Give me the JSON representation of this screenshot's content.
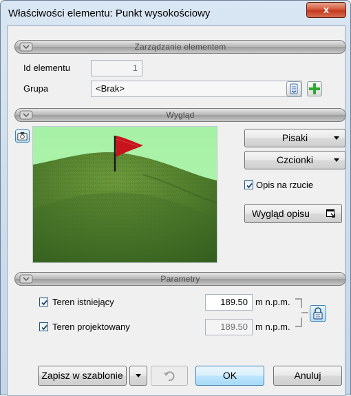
{
  "window": {
    "title": "Właściwości elementu: Punkt wysokościowy",
    "close_glyph": "x"
  },
  "sections": {
    "management": {
      "title": "Zarządzanie elementem"
    },
    "appearance": {
      "title": "Wygląd"
    },
    "parameters": {
      "title": "Parametry"
    }
  },
  "management": {
    "id_label": "Id elementu",
    "id_value": "1",
    "group_label": "Grupa",
    "group_value": "<Brak>"
  },
  "appearance": {
    "pens_label": "Pisaki",
    "fonts_label": "Czcionki",
    "plan_description_label": "Opis na rzucie",
    "plan_description_checked": true,
    "description_look_label": "Wygląd opisu"
  },
  "parameters": {
    "existing_label": "Teren istniejący",
    "existing_checked": true,
    "existing_value": "189.50",
    "existing_unit": "m n.p.m.",
    "designed_label": "Teren projektowany",
    "designed_checked": true,
    "designed_value": "189.50",
    "designed_unit": "m n.p.m."
  },
  "footer": {
    "save_template_label": "Zapisz w szablonie",
    "ok_label": "OK",
    "cancel_label": "Anuluj"
  },
  "colors": {
    "terrain_green": "#4a7a2a",
    "sky_green": "#a8f0a8",
    "flag_red": "#c8141c",
    "accent_blue": "#3c7fb1"
  },
  "icons": [
    "close-icon",
    "collapse-icon",
    "camera-icon",
    "group-picker-icon",
    "add-icon",
    "chevron-down-icon",
    "popout-icon",
    "undo-icon",
    "lock-icon",
    "checkmark-icon"
  ]
}
